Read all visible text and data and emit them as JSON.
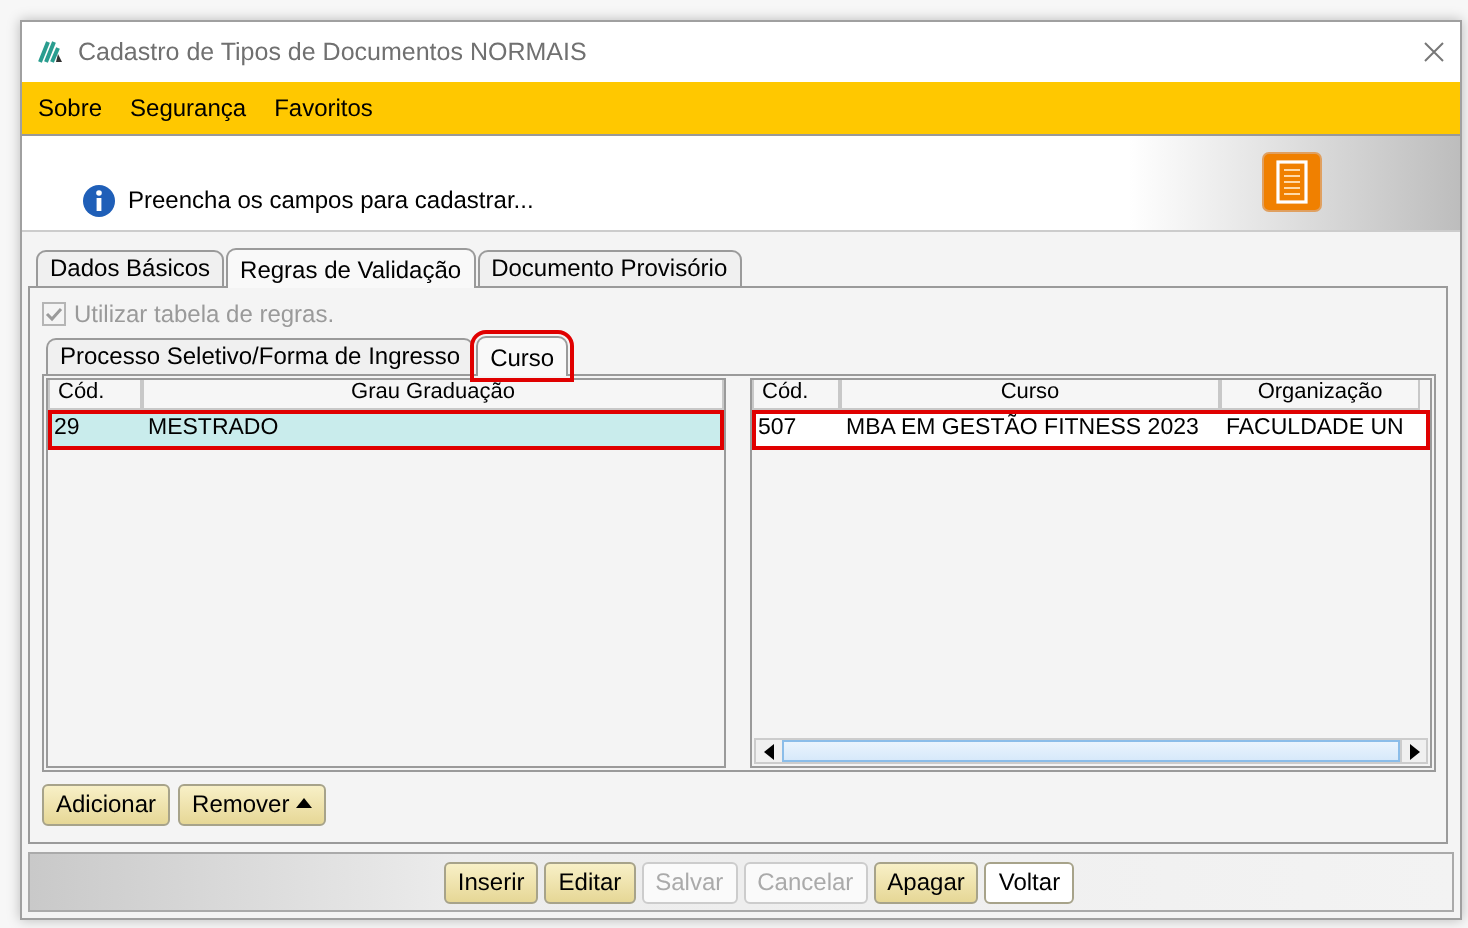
{
  "window": {
    "title": "Cadastro de Tipos de Documentos NORMAIS"
  },
  "menu": [
    "Sobre",
    "Segurança",
    "Favoritos"
  ],
  "header": {
    "message": "Preencha os campos para cadastrar..."
  },
  "tabs": [
    {
      "label": "Dados Básicos",
      "selected": false
    },
    {
      "label": "Regras de Validação",
      "selected": true
    },
    {
      "label": "Documento Provisório",
      "selected": false
    }
  ],
  "use_rules": {
    "label": "Utilizar tabela de regras.",
    "checked": true,
    "disabled": true
  },
  "subtabs": [
    {
      "label": "Processo Seletivo/Forma de Ingresso",
      "selected": false,
      "outlined": false
    },
    {
      "label": "Curso",
      "selected": true,
      "outlined": true
    }
  ],
  "grau_table": {
    "columns": [
      "Cód.",
      "Grau Graduação"
    ],
    "rows": [
      {
        "cells": [
          "29",
          "MESTRADO"
        ],
        "selected": true,
        "outlined": true
      }
    ]
  },
  "curso_table": {
    "columns": [
      "Cód.",
      "Curso",
      "Organização"
    ],
    "rows": [
      {
        "cells": [
          "507",
          "MBA EM GESTÃO FITNESS 2023",
          "FACULDADE UN"
        ],
        "selected": false,
        "outlined": true
      }
    ]
  },
  "grid_buttons": [
    {
      "label": "Adicionar",
      "kind": "plain"
    },
    {
      "label": "Remover",
      "kind": "dropdown"
    }
  ],
  "footer_buttons": [
    {
      "label": "Inserir",
      "disabled": false,
      "primary": true
    },
    {
      "label": "Editar",
      "disabled": false,
      "primary": true
    },
    {
      "label": "Salvar",
      "disabled": true,
      "primary": false
    },
    {
      "label": "Cancelar",
      "disabled": true,
      "primary": false
    },
    {
      "label": "Apagar",
      "disabled": false,
      "primary": true
    },
    {
      "label": "Voltar",
      "disabled": false,
      "primary": false
    }
  ]
}
